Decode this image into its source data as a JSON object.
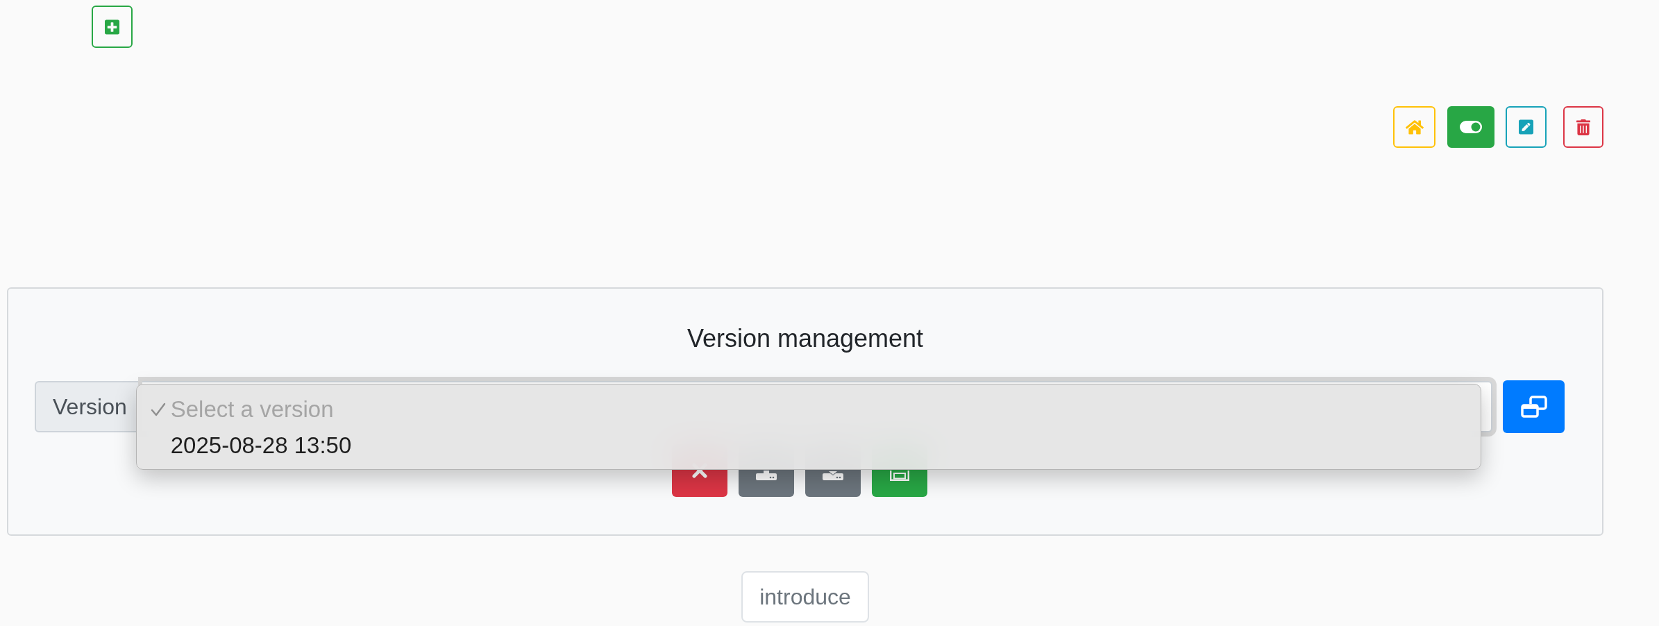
{
  "toolbar": [
    {
      "kind": "home"
    },
    {
      "kind": "toggle",
      "on": true
    },
    {
      "kind": "edit"
    },
    {
      "kind": "delete"
    }
  ],
  "version_panel": {
    "title": "Version management",
    "input_label": "Version",
    "select": {
      "expanded": true,
      "options": [
        {
          "label": "Select a version",
          "selected": true,
          "disabled": true
        },
        {
          "label": "2025-08-28 13:50",
          "selected": false,
          "disabled": false
        }
      ]
    },
    "actions": [
      {
        "kind": "cancel"
      },
      {
        "kind": "upload"
      },
      {
        "kind": "download"
      },
      {
        "kind": "save"
      }
    ]
  },
  "introduce_button": {
    "label": "introduce"
  }
}
